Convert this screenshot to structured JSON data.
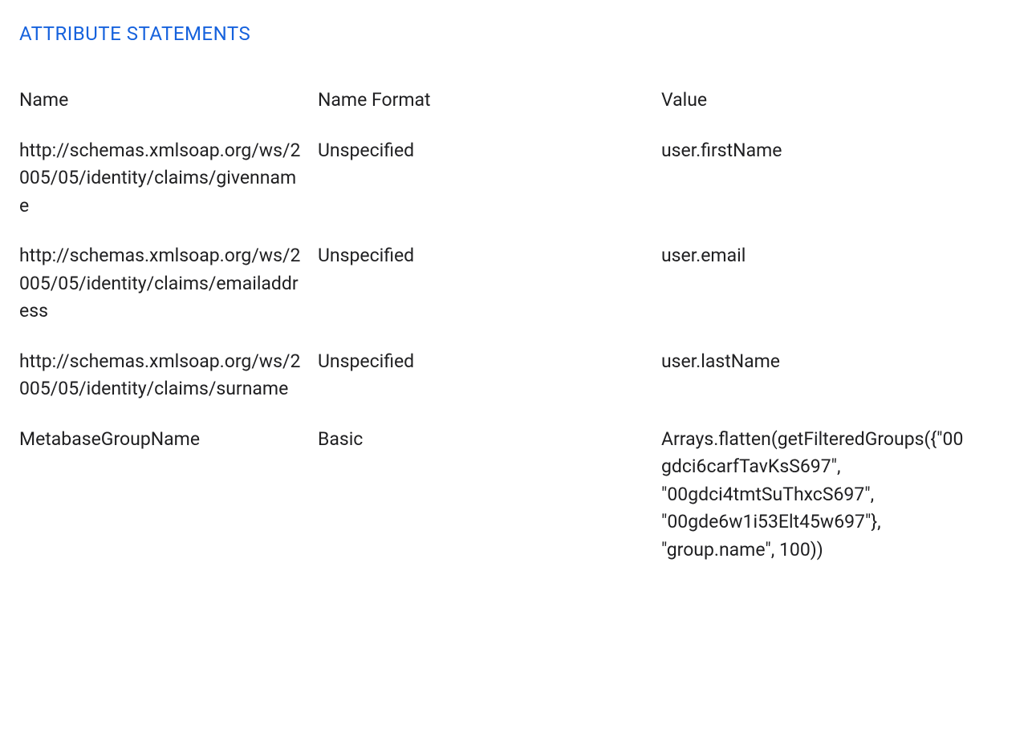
{
  "section": {
    "title": "ATTRIBUTE STATEMENTS"
  },
  "table": {
    "headers": {
      "name": "Name",
      "format": "Name Format",
      "value": "Value"
    },
    "rows": [
      {
        "name": "http://schemas.xmlsoap.org/ws/2005/05/identity/claims/givenname",
        "format": "Unspecified",
        "value": "user.firstName"
      },
      {
        "name": "http://schemas.xmlsoap.org/ws/2005/05/identity/claims/emailaddress",
        "format": "Unspecified",
        "value": "user.email"
      },
      {
        "name": "http://schemas.xmlsoap.org/ws/2005/05/identity/claims/surname",
        "format": "Unspecified",
        "value": "user.lastName"
      },
      {
        "name": "MetabaseGroupName",
        "format": "Basic",
        "value": "Arrays.flatten(getFilteredGroups({\"00gdci6carfTavKsS697\", \"00gdci4tmtSuThxcS697\", \"00gde6w1i53Elt45w697\"}, \"group.name\", 100))"
      }
    ]
  }
}
